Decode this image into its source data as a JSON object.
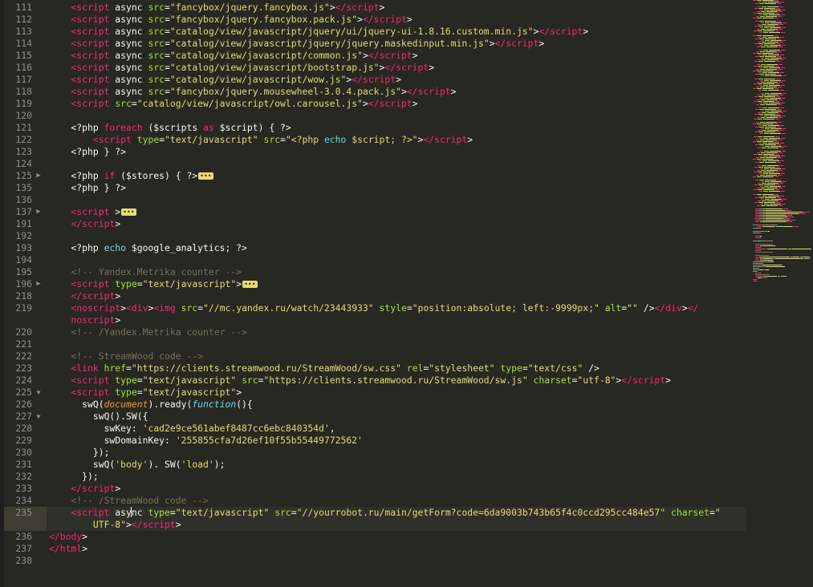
{
  "editor": {
    "theme_colors": {
      "background": "#272822",
      "tag": "#f92672",
      "attribute": "#a6e22e",
      "string": "#e6db74",
      "keyword": "#66d9ef",
      "comment": "#75715e",
      "text": "#f8f8f2"
    },
    "lines": [
      {
        "n": "111",
        "seg": [
          [
            "pl",
            "    "
          ],
          [
            "tag",
            "<script"
          ],
          [
            "pl",
            " async "
          ],
          [
            "attr",
            "src"
          ],
          [
            "pl",
            "="
          ],
          [
            "str",
            "\"fancybox/jquery.fancybox.js\""
          ],
          [
            "pl",
            ">"
          ],
          [
            "tag",
            "</script"
          ],
          [
            "pl",
            ">"
          ]
        ]
      },
      {
        "n": "112",
        "seg": [
          [
            "pl",
            "    "
          ],
          [
            "tag",
            "<script"
          ],
          [
            "pl",
            " async "
          ],
          [
            "attr",
            "src"
          ],
          [
            "pl",
            "="
          ],
          [
            "str",
            "\"fancybox/jquery.fancybox.pack.js\""
          ],
          [
            "pl",
            ">"
          ],
          [
            "tag",
            "</script"
          ],
          [
            "pl",
            ">"
          ]
        ]
      },
      {
        "n": "113",
        "seg": [
          [
            "pl",
            "    "
          ],
          [
            "tag",
            "<script"
          ],
          [
            "pl",
            " async "
          ],
          [
            "attr",
            "src"
          ],
          [
            "pl",
            "="
          ],
          [
            "str",
            "\"catalog/view/javascript/jquery/ui/jquery-ui-1.8.16.custom.min.js\""
          ],
          [
            "pl",
            ">"
          ],
          [
            "tag",
            "</script"
          ],
          [
            "pl",
            ">"
          ]
        ]
      },
      {
        "n": "114",
        "seg": [
          [
            "pl",
            "    "
          ],
          [
            "tag",
            "<script"
          ],
          [
            "pl",
            " async "
          ],
          [
            "attr",
            "src"
          ],
          [
            "pl",
            "="
          ],
          [
            "str",
            "\"catalog/view/javascript/jquery/jquery.maskedinput.min.js\""
          ],
          [
            "pl",
            ">"
          ],
          [
            "tag",
            "</script"
          ],
          [
            "pl",
            ">"
          ]
        ]
      },
      {
        "n": "115",
        "seg": [
          [
            "pl",
            "    "
          ],
          [
            "tag",
            "<script"
          ],
          [
            "pl",
            " async "
          ],
          [
            "attr",
            "src"
          ],
          [
            "pl",
            "="
          ],
          [
            "str",
            "\"catalog/view/javascript/common.js\""
          ],
          [
            "pl",
            ">"
          ],
          [
            "tag",
            "</script"
          ],
          [
            "pl",
            ">"
          ]
        ]
      },
      {
        "n": "116",
        "seg": [
          [
            "pl",
            "    "
          ],
          [
            "tag",
            "<script"
          ],
          [
            "pl",
            " async "
          ],
          [
            "attr",
            "src"
          ],
          [
            "pl",
            "="
          ],
          [
            "str",
            "\"catalog/view/javascript/bootstrap.js\""
          ],
          [
            "pl",
            ">"
          ],
          [
            "tag",
            "</script"
          ],
          [
            "pl",
            ">"
          ]
        ]
      },
      {
        "n": "117",
        "seg": [
          [
            "pl",
            "    "
          ],
          [
            "tag",
            "<script"
          ],
          [
            "pl",
            " async "
          ],
          [
            "attr",
            "src"
          ],
          [
            "pl",
            "="
          ],
          [
            "str",
            "\"catalog/view/javascript/wow.js\""
          ],
          [
            "pl",
            ">"
          ],
          [
            "tag",
            "</script"
          ],
          [
            "pl",
            ">"
          ]
        ]
      },
      {
        "n": "118",
        "seg": [
          [
            "pl",
            "    "
          ],
          [
            "tag",
            "<script"
          ],
          [
            "pl",
            " async "
          ],
          [
            "attr",
            "src"
          ],
          [
            "pl",
            "="
          ],
          [
            "str",
            "\"fancybox/jquery.mousewheel-3.0.4.pack.js\""
          ],
          [
            "pl",
            ">"
          ],
          [
            "tag",
            "</script"
          ],
          [
            "pl",
            ">"
          ]
        ]
      },
      {
        "n": "119",
        "seg": [
          [
            "pl",
            "    "
          ],
          [
            "tag",
            "<script"
          ],
          [
            "pl",
            " "
          ],
          [
            "attr",
            "src"
          ],
          [
            "pl",
            "="
          ],
          [
            "str",
            "\"catalog/view/javascript/owl.carousel.js\""
          ],
          [
            "pl",
            ">"
          ],
          [
            "tag",
            "</script"
          ],
          [
            "pl",
            ">"
          ]
        ]
      },
      {
        "n": "120",
        "seg": []
      },
      {
        "n": "121",
        "seg": [
          [
            "pl",
            "    <?php "
          ],
          [
            "tag",
            "foreach"
          ],
          [
            "pl",
            " ($scripts "
          ],
          [
            "tag",
            "as"
          ],
          [
            "pl",
            " $script) { ?>"
          ]
        ]
      },
      {
        "n": "122",
        "seg": [
          [
            "pl",
            "        "
          ],
          [
            "tag",
            "<script"
          ],
          [
            "pl",
            " "
          ],
          [
            "attr",
            "type"
          ],
          [
            "pl",
            "="
          ],
          [
            "str",
            "\"text/javascript\""
          ],
          [
            "pl",
            " "
          ],
          [
            "attr",
            "src"
          ],
          [
            "pl",
            "="
          ],
          [
            "str",
            "\"<?php "
          ],
          [
            "kw",
            "echo"
          ],
          [
            "str",
            " $script; ?>\""
          ],
          [
            "pl",
            ">"
          ],
          [
            "tag",
            "</script"
          ],
          [
            "pl",
            ">"
          ]
        ]
      },
      {
        "n": "123",
        "seg": [
          [
            "pl",
            "    <?php } ?>"
          ]
        ]
      },
      {
        "n": "124",
        "seg": []
      },
      {
        "n": "125",
        "fold": "right",
        "seg": [
          [
            "pl",
            "    <?php "
          ],
          [
            "tag",
            "if"
          ],
          [
            "pl",
            " ($stores) { ?>"
          ],
          [
            "marker",
            "•••"
          ]
        ]
      },
      {
        "n": "135",
        "seg": [
          [
            "pl",
            "    <?php } ?>"
          ]
        ]
      },
      {
        "n": "136",
        "seg": []
      },
      {
        "n": "137",
        "fold": "right",
        "seg": [
          [
            "pl",
            "    "
          ],
          [
            "tag",
            "<script"
          ],
          [
            "pl",
            " >"
          ],
          [
            "marker",
            "•••"
          ]
        ]
      },
      {
        "n": "191",
        "seg": [
          [
            "pl",
            "    "
          ],
          [
            "tag",
            "</script"
          ],
          [
            "pl",
            ">"
          ]
        ]
      },
      {
        "n": "192",
        "seg": []
      },
      {
        "n": "193",
        "seg": [
          [
            "pl",
            "    <?php "
          ],
          [
            "kw",
            "echo"
          ],
          [
            "pl",
            " $google_analytics; ?>"
          ]
        ]
      },
      {
        "n": "194",
        "seg": []
      },
      {
        "n": "195",
        "seg": [
          [
            "pl",
            "    "
          ],
          [
            "cmt",
            "<!-- Yandex.Metrika counter -->"
          ]
        ]
      },
      {
        "n": "196",
        "fold": "right",
        "seg": [
          [
            "pl",
            "    "
          ],
          [
            "tag",
            "<script"
          ],
          [
            "pl",
            " "
          ],
          [
            "attr",
            "type"
          ],
          [
            "pl",
            "="
          ],
          [
            "str",
            "\"text/javascript\""
          ],
          [
            "pl",
            ">"
          ],
          [
            "marker",
            "•••"
          ]
        ]
      },
      {
        "n": "218",
        "seg": [
          [
            "pl",
            "    "
          ],
          [
            "tag",
            "</script"
          ],
          [
            "pl",
            ">"
          ]
        ]
      },
      {
        "n": "219",
        "seg": [
          [
            "pl",
            "    "
          ],
          [
            "tag",
            "<noscript"
          ],
          [
            "pl",
            ">"
          ],
          [
            "tag",
            "<div"
          ],
          [
            "pl",
            ">"
          ],
          [
            "tag",
            "<img"
          ],
          [
            "pl",
            " "
          ],
          [
            "attr",
            "src"
          ],
          [
            "pl",
            "="
          ],
          [
            "str",
            "\"//mc.yandex.ru/watch/23443933\""
          ],
          [
            "pl",
            " "
          ],
          [
            "attr",
            "style"
          ],
          [
            "pl",
            "="
          ],
          [
            "str",
            "\"position:absolute; left:-9999px;\""
          ],
          [
            "pl",
            " "
          ],
          [
            "attr",
            "alt"
          ],
          [
            "pl",
            "="
          ],
          [
            "str",
            "\"\""
          ],
          [
            "pl",
            " />"
          ],
          [
            "tag",
            "</div"
          ],
          [
            "pl",
            ">"
          ],
          [
            "tag",
            "</"
          ]
        ]
      },
      {
        "n": "",
        "seg": [
          [
            "pl",
            "    "
          ],
          [
            "tag",
            "noscript"
          ],
          [
            "pl",
            ">"
          ]
        ]
      },
      {
        "n": "220",
        "seg": [
          [
            "pl",
            "    "
          ],
          [
            "cmt",
            "<!-- /Yandex.Metrika counter -->"
          ]
        ]
      },
      {
        "n": "221",
        "seg": []
      },
      {
        "n": "222",
        "seg": [
          [
            "pl",
            "    "
          ],
          [
            "cmt",
            "<!-- StreamWood code -->"
          ]
        ]
      },
      {
        "n": "223",
        "seg": [
          [
            "pl",
            "    "
          ],
          [
            "tag",
            "<link"
          ],
          [
            "pl",
            " "
          ],
          [
            "attr",
            "href"
          ],
          [
            "pl",
            "="
          ],
          [
            "str",
            "\"https://clients.streamwood.ru/StreamWood/sw.css\""
          ],
          [
            "pl",
            " "
          ],
          [
            "attr",
            "rel"
          ],
          [
            "pl",
            "="
          ],
          [
            "str",
            "\"stylesheet\""
          ],
          [
            "pl",
            " "
          ],
          [
            "attr",
            "type"
          ],
          [
            "pl",
            "="
          ],
          [
            "str",
            "\"text/css\""
          ],
          [
            "pl",
            " />"
          ]
        ]
      },
      {
        "n": "224",
        "seg": [
          [
            "pl",
            "    "
          ],
          [
            "tag",
            "<script"
          ],
          [
            "pl",
            " "
          ],
          [
            "attr",
            "type"
          ],
          [
            "pl",
            "="
          ],
          [
            "str",
            "\"text/javascript\""
          ],
          [
            "pl",
            " "
          ],
          [
            "attr",
            "src"
          ],
          [
            "pl",
            "="
          ],
          [
            "str",
            "\"https://clients.streamwood.ru/StreamWood/sw.js\""
          ],
          [
            "pl",
            " "
          ],
          [
            "attr",
            "charset"
          ],
          [
            "pl",
            "="
          ],
          [
            "str",
            "\"utf-8\""
          ],
          [
            "pl",
            ">"
          ],
          [
            "tag",
            "</script"
          ],
          [
            "pl",
            ">"
          ]
        ]
      },
      {
        "n": "225",
        "fold": "down",
        "seg": [
          [
            "pl",
            "    "
          ],
          [
            "tag",
            "<script"
          ],
          [
            "pl",
            " "
          ],
          [
            "attr",
            "type"
          ],
          [
            "pl",
            "="
          ],
          [
            "str",
            "\"text/javascript\""
          ],
          [
            "pl",
            ">"
          ]
        ]
      },
      {
        "n": "226",
        "seg": [
          [
            "pl",
            "      swQ("
          ],
          [
            "param",
            "document"
          ],
          [
            "pl",
            ").ready("
          ],
          [
            "fn",
            "function"
          ],
          [
            "pl",
            "(){"
          ]
        ]
      },
      {
        "n": "227",
        "fold": "down",
        "seg": [
          [
            "pl",
            "        swQ().SW({"
          ]
        ]
      },
      {
        "n": "228",
        "seg": [
          [
            "pl",
            "          swKey: "
          ],
          [
            "str",
            "'cad2e9ce561abef8487cc6ebc840354d'"
          ],
          [
            "pl",
            ","
          ]
        ]
      },
      {
        "n": "229",
        "seg": [
          [
            "pl",
            "          swDomainKey: "
          ],
          [
            "str",
            "'255855cfa7d26ef10f55b55449772562'"
          ]
        ]
      },
      {
        "n": "230",
        "seg": [
          [
            "pl",
            "        });"
          ]
        ]
      },
      {
        "n": "231",
        "seg": [
          [
            "pl",
            "        swQ("
          ],
          [
            "str",
            "'body'"
          ],
          [
            "pl",
            "). SW("
          ],
          [
            "str",
            "'load'"
          ],
          [
            "pl",
            ");"
          ]
        ]
      },
      {
        "n": "232",
        "seg": [
          [
            "pl",
            "      });"
          ]
        ]
      },
      {
        "n": "233",
        "seg": [
          [
            "pl",
            "    "
          ],
          [
            "tag",
            "</script"
          ],
          [
            "pl",
            ">"
          ]
        ]
      },
      {
        "n": "234",
        "seg": [
          [
            "pl",
            "    "
          ],
          [
            "cmt",
            "<!-- /StreamWood code -->"
          ]
        ]
      },
      {
        "n": "235",
        "current": true,
        "seg": [
          [
            "pl",
            "    "
          ],
          [
            "tag",
            "<script"
          ],
          [
            "pl",
            " asy"
          ],
          [
            "caret",
            ""
          ],
          [
            "pl",
            "nc "
          ],
          [
            "attr",
            "type"
          ],
          [
            "pl",
            "="
          ],
          [
            "str",
            "\"text/javascript\""
          ],
          [
            "pl",
            " "
          ],
          [
            "attr",
            "src"
          ],
          [
            "pl",
            "="
          ],
          [
            "str",
            "\"//yourrobot.ru/main/getForm?code=6da9003b743b65f4c0ccd295cc484e57\""
          ],
          [
            "pl",
            " "
          ],
          [
            "attr",
            "charset"
          ],
          [
            "pl",
            "="
          ],
          [
            "str",
            "\""
          ]
        ]
      },
      {
        "n": "",
        "current": true,
        "seg": [
          [
            "pl",
            "        "
          ],
          [
            "str",
            "UTF-8\""
          ],
          [
            "pl",
            ">"
          ],
          [
            "tag",
            "</script"
          ],
          [
            "pl",
            ">"
          ]
        ]
      },
      {
        "n": "236",
        "seg": [
          [
            "tag",
            "</body"
          ],
          [
            "pl",
            ">"
          ]
        ]
      },
      {
        "n": "237",
        "seg": [
          [
            "tag",
            "</html"
          ],
          [
            "pl",
            ">"
          ]
        ]
      },
      {
        "n": "238",
        "seg": []
      }
    ]
  }
}
